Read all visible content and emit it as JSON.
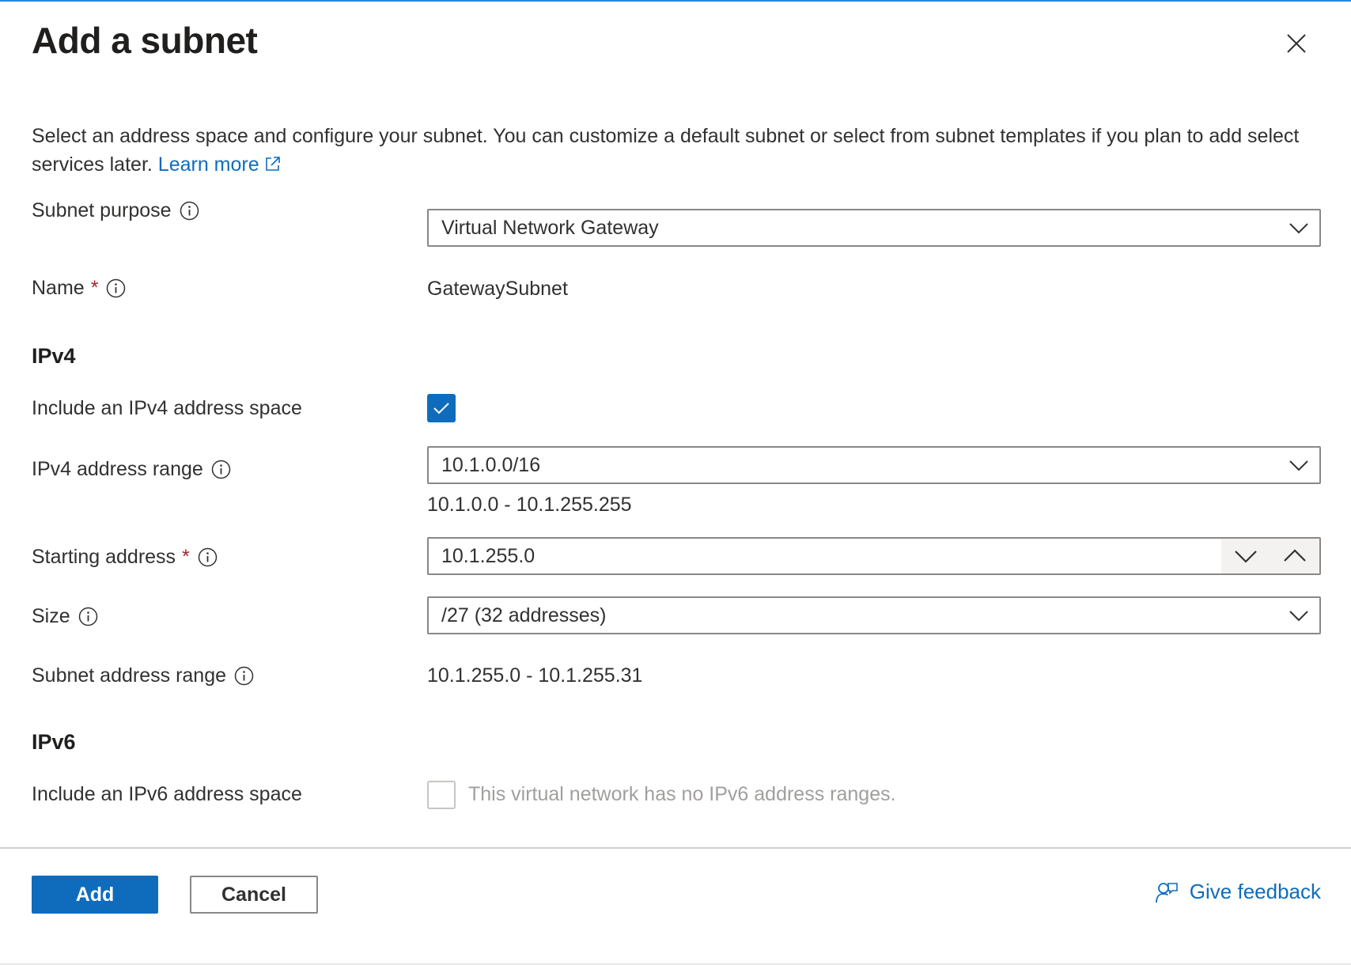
{
  "panel": {
    "title": "Add a subnet",
    "description": "Select an address space and configure your subnet. You can customize a default subnet or select from subnet templates if you plan to add select services later.",
    "learn_more": "Learn more"
  },
  "fields": {
    "subnet_purpose": {
      "label": "Subnet purpose",
      "value": "Virtual Network Gateway"
    },
    "name": {
      "label": "Name",
      "required_mark": "*",
      "value": "GatewaySubnet"
    }
  },
  "ipv4": {
    "heading": "IPv4",
    "include_label": "Include an IPv4 address space",
    "include_checked": true,
    "range_label": "IPv4 address range",
    "range_value": "10.1.0.0/16",
    "range_span": "10.1.0.0 - 10.1.255.255",
    "start_label": "Starting address",
    "start_required": "*",
    "start_value": "10.1.255.0",
    "size_label": "Size",
    "size_value": "/27 (32 addresses)",
    "subnet_range_label": "Subnet address range",
    "subnet_range_value": "10.1.255.0 - 10.1.255.31"
  },
  "ipv6": {
    "heading": "IPv6",
    "include_label": "Include an IPv6 address space",
    "include_checked": false,
    "disabled_note": "This virtual network has no IPv6 address ranges."
  },
  "footer": {
    "add_label": "Add",
    "cancel_label": "Cancel",
    "feedback_label": "Give feedback"
  },
  "colors": {
    "accent": "#0f6cbd",
    "required": "#a4262c",
    "border": "#8a8886"
  },
  "icons": [
    "close-icon",
    "external-link-icon",
    "info-icon",
    "chevron-down-icon",
    "chevron-up-icon",
    "checkmark-icon",
    "feedback-icon"
  ]
}
